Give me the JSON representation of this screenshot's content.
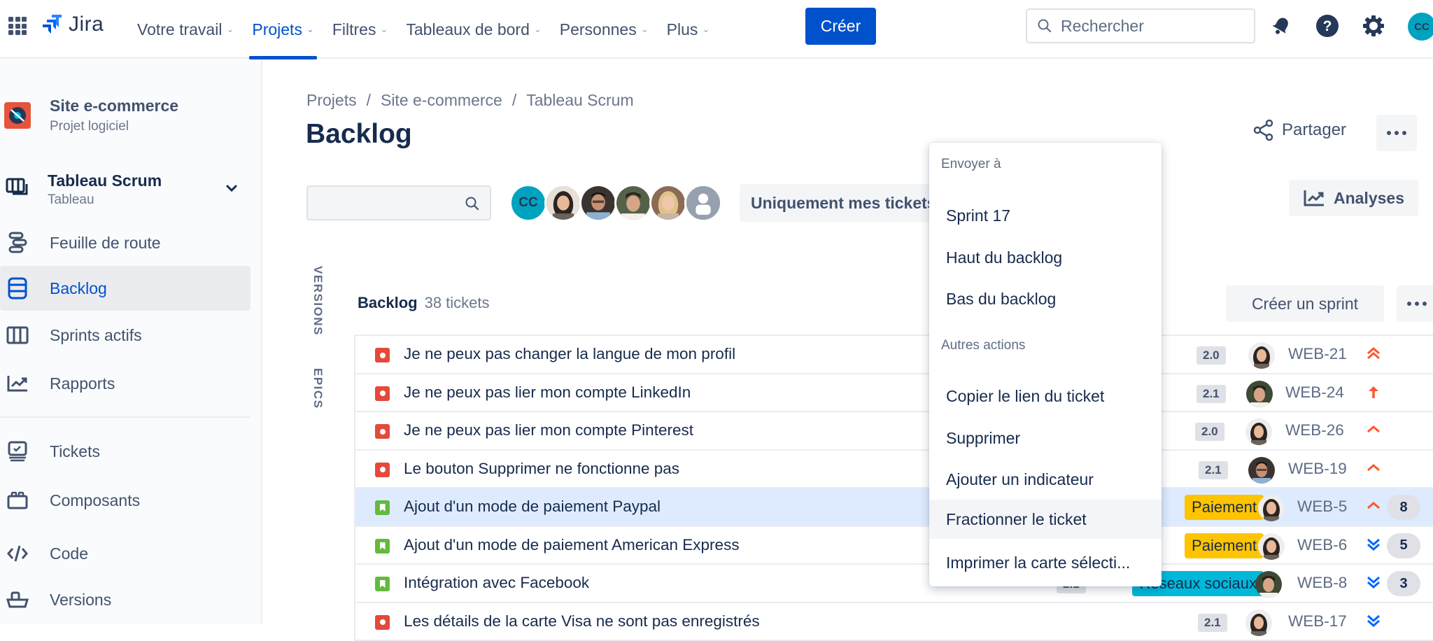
{
  "topbar": {
    "app_name": "Jira",
    "nav": [
      {
        "label": "Votre travail",
        "active": false
      },
      {
        "label": "Projets",
        "active": true
      },
      {
        "label": "Filtres",
        "active": false
      },
      {
        "label": "Tableaux de bord",
        "active": false
      },
      {
        "label": "Personnes",
        "active": false
      },
      {
        "label": "Plus",
        "active": false
      }
    ],
    "create_label": "Créer",
    "search_placeholder": "Rechercher",
    "user_initials": "CC",
    "icons": [
      "notifications-bell-icon",
      "help-icon",
      "settings-gear-icon"
    ]
  },
  "sidebar": {
    "project_name": "Site e-commerce",
    "project_type": "Projet logiciel",
    "board_name": "Tableau Scrum",
    "board_type": "Tableau",
    "items": [
      {
        "label": "Feuille de route",
        "icon": "roadmap-icon",
        "active": false
      },
      {
        "label": "Backlog",
        "icon": "backlog-icon",
        "active": true
      },
      {
        "label": "Sprints actifs",
        "icon": "board-columns-icon",
        "active": false
      },
      {
        "label": "Rapports",
        "icon": "reports-chart-icon",
        "active": false
      },
      {
        "label": "Tickets",
        "icon": "issues-icon",
        "active": false
      },
      {
        "label": "Composants",
        "icon": "components-icon",
        "active": false
      },
      {
        "label": "Code",
        "icon": "code-icon",
        "active": false
      },
      {
        "label": "Versions",
        "icon": "releases-ship-icon",
        "active": false
      }
    ]
  },
  "main": {
    "breadcrumb": [
      "Projets",
      "Site e-commerce",
      "Tableau Scrum"
    ],
    "breadcrumb_sep": "/",
    "title": "Backlog",
    "share_label": "Partager",
    "only_mine_label": "Uniquement mes tickets",
    "analyses_label": "Analyses",
    "side_tabs": [
      "VERSIONS",
      "EPICS"
    ],
    "backlog": {
      "label": "Backlog",
      "count": "38 tickets",
      "create_sprint_label": "Créer un sprint"
    },
    "issues": [
      {
        "type": "bug",
        "summary": "Je ne peux pas changer la langue de mon profil",
        "version": "2.0",
        "epic": "",
        "key": "WEB-21",
        "priority": "highest",
        "points": ""
      },
      {
        "type": "bug",
        "summary": "Je ne peux pas lier mon compte LinkedIn",
        "version": "2.1",
        "epic": "",
        "key": "WEB-24",
        "priority": "high-arrow",
        "points": ""
      },
      {
        "type": "bug",
        "summary": "Je ne peux pas lier mon compte Pinterest",
        "version": "2.0",
        "epic": "",
        "key": "WEB-26",
        "priority": "medium-high",
        "points": ""
      },
      {
        "type": "bug",
        "summary": "Le bouton Supprimer ne fonctionne pas",
        "version": "2.1",
        "epic": "",
        "key": "WEB-19",
        "priority": "medium-high",
        "points": ""
      },
      {
        "type": "story",
        "summary": "Ajout d'un mode de paiement Paypal",
        "version": "",
        "epic": "Paiement",
        "epic_color": "#ffc400",
        "key": "WEB-5",
        "priority": "medium-high",
        "points": "8",
        "selected": true
      },
      {
        "type": "story",
        "summary": "Ajout d'un mode de paiement American Express",
        "version": "",
        "epic": "Paiement",
        "epic_color": "#ffc400",
        "key": "WEB-6",
        "priority": "lowest",
        "points": "5"
      },
      {
        "type": "story",
        "summary": "Intégration avec Facebook",
        "version": "2.1",
        "epic": "Réseaux sociaux",
        "epic_color": "#00b8d9",
        "key": "WEB-8",
        "priority": "lowest",
        "points": "3"
      },
      {
        "type": "bug",
        "summary": "Les détails de la carte Visa ne sont pas enregistrés",
        "version": "2.1",
        "epic": "",
        "key": "WEB-17",
        "priority": "lowest",
        "points": ""
      }
    ]
  },
  "context_menu": {
    "group1": "Envoyer à",
    "group1_items": [
      "Sprint 17",
      "Haut du backlog",
      "Bas du backlog"
    ],
    "group2": "Autres actions",
    "group2_items": [
      "Copier le lien du ticket",
      "Supprimer",
      "Ajouter un indicateur",
      "Fractionner le ticket",
      "Imprimer la carte sélecti..."
    ],
    "hovered_item": "Fractionner le ticket"
  },
  "colors": {
    "brand": "#0052cc",
    "bug": "#e5493a",
    "story": "#63ba3c",
    "priority_high": "#ff5630",
    "priority_low": "#0065ff"
  }
}
